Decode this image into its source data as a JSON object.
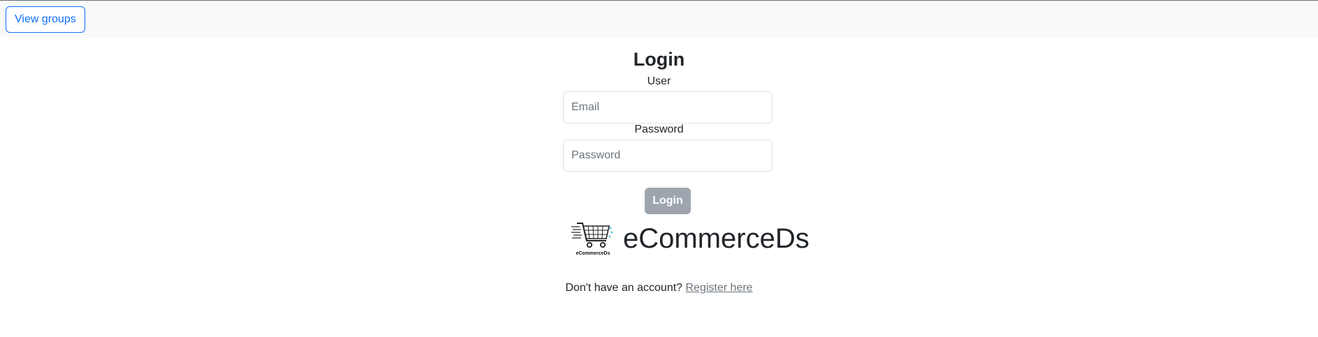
{
  "navbar": {
    "view_groups_label": "View groups"
  },
  "login": {
    "title": "Login",
    "user_label": "User",
    "email_placeholder": "Email",
    "password_label": "Password",
    "password_placeholder": "Password",
    "submit_label": "Login"
  },
  "brand": {
    "logo_caption": "eCommerceDs",
    "name": "eCommerceDs",
    "logo_icon": "shopping-cart-icon"
  },
  "register": {
    "prompt": "Don't have an account?",
    "link_label": "Register here"
  },
  "colors": {
    "primary": "#0d6efd",
    "button_disabled": "#9ea5af",
    "navbar_bg": "#f8f9fa",
    "link_muted": "#6c757d"
  }
}
